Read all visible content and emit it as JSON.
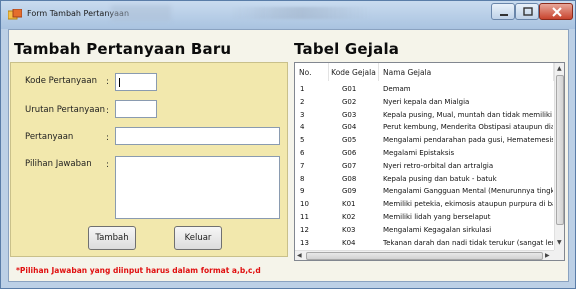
{
  "window": {
    "title": "Form Tambah Pertanyaan"
  },
  "form": {
    "heading": "Tambah Pertanyaan Baru",
    "fields": [
      {
        "label": "Kode Pertanyaan",
        "colon": ":",
        "value": ""
      },
      {
        "label": "Urutan Pertanyaan",
        "colon": ":",
        "value": ""
      },
      {
        "label": "Pertanyaan",
        "colon": ":",
        "value": ""
      },
      {
        "label": "Pilihan Jawaban",
        "colon": ":",
        "value": ""
      }
    ],
    "buttons": {
      "add": "Tambah",
      "exit": "Keluar"
    },
    "warning": "*Pilihan Jawaban yang diinput harus dalam format a,b,c,d"
  },
  "table": {
    "heading": "Tabel Gejala",
    "columns": [
      "No.",
      "Kode Gejala",
      "Nama Gejala"
    ],
    "rows": [
      [
        "1",
        "G01",
        "Demam"
      ],
      [
        "2",
        "G02",
        "Nyeri kepala dan Mialgia"
      ],
      [
        "3",
        "G03",
        "Kepala pusing, Mual, muntah dan tidak memiliki na"
      ],
      [
        "4",
        "G04",
        "Perut kembung, Menderita Obstipasi ataupun diare"
      ],
      [
        "5",
        "G05",
        "Mengalami pendarahan pada gusi, Hematemesis at"
      ],
      [
        "6",
        "G06",
        "Megalami Epistaksis"
      ],
      [
        "7",
        "G07",
        "Nyeri retro-orbital dan artralgia"
      ],
      [
        "8",
        "G08",
        "Kepala pusing dan batuk - batuk"
      ],
      [
        "9",
        "G09",
        "Mengalami Gangguan Mental (Menurunnya tingkat"
      ],
      [
        "10",
        "K01",
        "Memiliki petekia, ekimosis ataupun purpura di bada"
      ],
      [
        "11",
        "K02",
        "Memiliki lidah yang berselaput"
      ],
      [
        "12",
        "K03",
        "Mengalami Kegagalan sirkulasi"
      ],
      [
        "13",
        "K04",
        "Tekanan darah dan nadi tidak terukur (sangat lem"
      ]
    ]
  }
}
